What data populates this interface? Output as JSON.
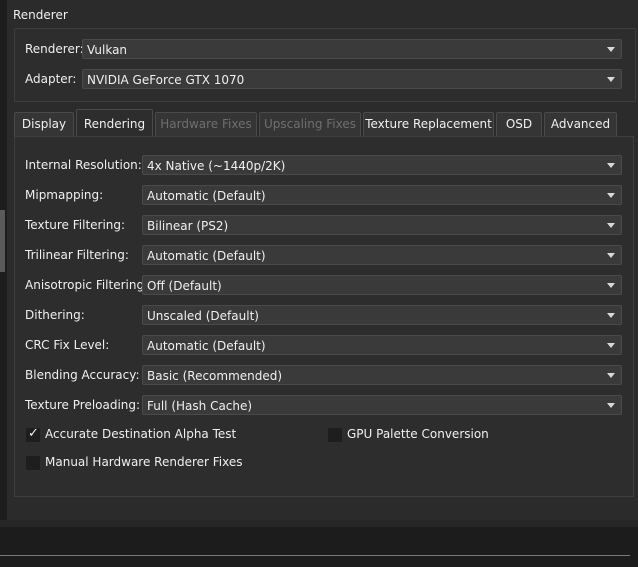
{
  "renderer_group": {
    "title": "Renderer",
    "renderer_label": "Renderer:",
    "renderer_value": "Vulkan",
    "adapter_label": "Adapter:",
    "adapter_value": "NVIDIA GeForce GTX 1070"
  },
  "tabs": [
    {
      "label": "Display",
      "state": "normal"
    },
    {
      "label": "Rendering",
      "state": "active"
    },
    {
      "label": "Hardware Fixes",
      "state": "disabled"
    },
    {
      "label": "Upscaling Fixes",
      "state": "disabled"
    },
    {
      "label": "Texture Replacement",
      "state": "normal"
    },
    {
      "label": "OSD",
      "state": "normal"
    },
    {
      "label": "Advanced",
      "state": "normal"
    }
  ],
  "settings": [
    {
      "label": "Internal Resolution:",
      "value": "4x Native (~1440p/2K)"
    },
    {
      "label": "Mipmapping:",
      "value": "Automatic (Default)"
    },
    {
      "label": "Texture Filtering:",
      "value": "Bilinear (PS2)"
    },
    {
      "label": "Trilinear Filtering:",
      "value": "Automatic (Default)"
    },
    {
      "label": "Anisotropic Filtering:",
      "value": "Off (Default)"
    },
    {
      "label": "Dithering:",
      "value": "Unscaled (Default)"
    },
    {
      "label": "CRC Fix Level:",
      "value": "Automatic (Default)"
    },
    {
      "label": "Blending Accuracy:",
      "value": "Basic (Recommended)"
    },
    {
      "label": "Texture Preloading:",
      "value": "Full (Hash Cache)"
    }
  ],
  "checkboxes": [
    {
      "label": "Accurate Destination Alpha Test",
      "checked": true
    },
    {
      "label": "GPU Palette Conversion",
      "checked": false
    },
    {
      "label": "Manual Hardware Renderer Fixes",
      "checked": false
    }
  ],
  "icons": {
    "dropdown": "chevron-down-icon",
    "check": "checkmark-icon"
  },
  "colors": {
    "background": "#2b2b2b",
    "panel": "#2d2d2d",
    "control": "#3a3a3a",
    "disabled_text": "#6f6f6f"
  }
}
